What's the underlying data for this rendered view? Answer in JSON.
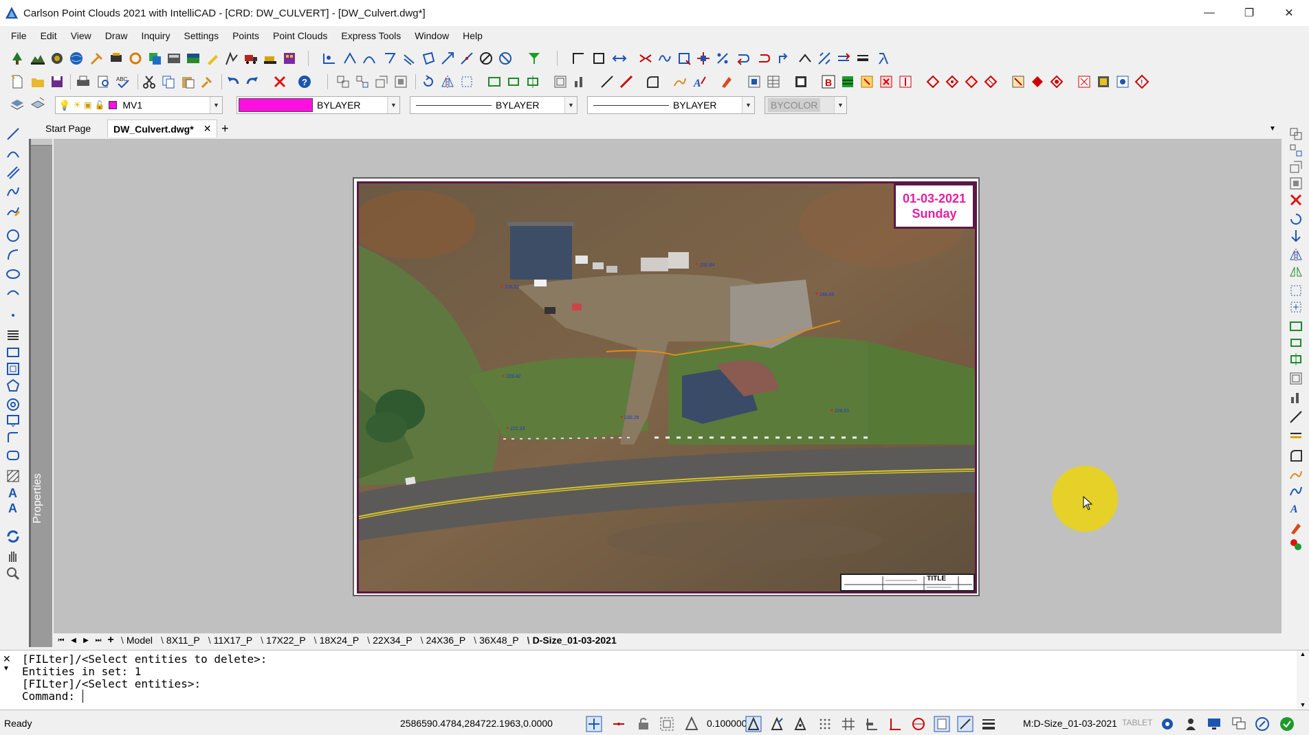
{
  "window": {
    "title": "Carlson Point Clouds 2021 with IntelliCAD - [CRD: DW_CULVERT] - [DW_Culvert.dwg*]",
    "minimize": "—",
    "restore": "❐",
    "close": "✕"
  },
  "menu": [
    "File",
    "Edit",
    "View",
    "Draw",
    "Inquiry",
    "Settings",
    "Points",
    "Point Clouds",
    "Express Tools",
    "Window",
    "Help"
  ],
  "properties_bar": {
    "layer": "MV1",
    "color": "BYLAYER",
    "color_swatch": "#ff10e0",
    "linetype": "BYLAYER",
    "lineweight": "BYLAYER",
    "plotstyle": "BYCOLOR"
  },
  "doc_tabs": {
    "start": "Start Page",
    "active": "DW_Culvert.dwg*",
    "close": "✕",
    "add": "+"
  },
  "panel": {
    "properties_label": "Properties"
  },
  "drawing": {
    "date": "01-03-2021",
    "day": "Sunday",
    "title_block": "TITLE",
    "point_labels": [
      "226.02",
      "232.84",
      "246.65",
      "229.42",
      "228.01",
      "230.29",
      "222.33"
    ]
  },
  "layout_tabs": [
    "Model",
    "8X11_P",
    "11X17_P",
    "17X22_P",
    "18X24_P",
    "22X34_P",
    "24X36_P",
    "36X48_P",
    "D-Size_01-03-2021"
  ],
  "command": {
    "lines": [
      "[FILter]/<Select entities to delete>:",
      "Entities in set: 1",
      "[FILter]/<Select entities>:",
      "Command: "
    ]
  },
  "status": {
    "ready": "Ready",
    "coords": "2586590.4784,284722.1963,0.0000",
    "scale": "0.100000",
    "layout": "M:D-Size_01-03-2021",
    "tablet": "TABLET"
  },
  "colors": {
    "accent": "#e61ea0",
    "frame": "#5a1845",
    "canvas": "#c0c0c0"
  }
}
